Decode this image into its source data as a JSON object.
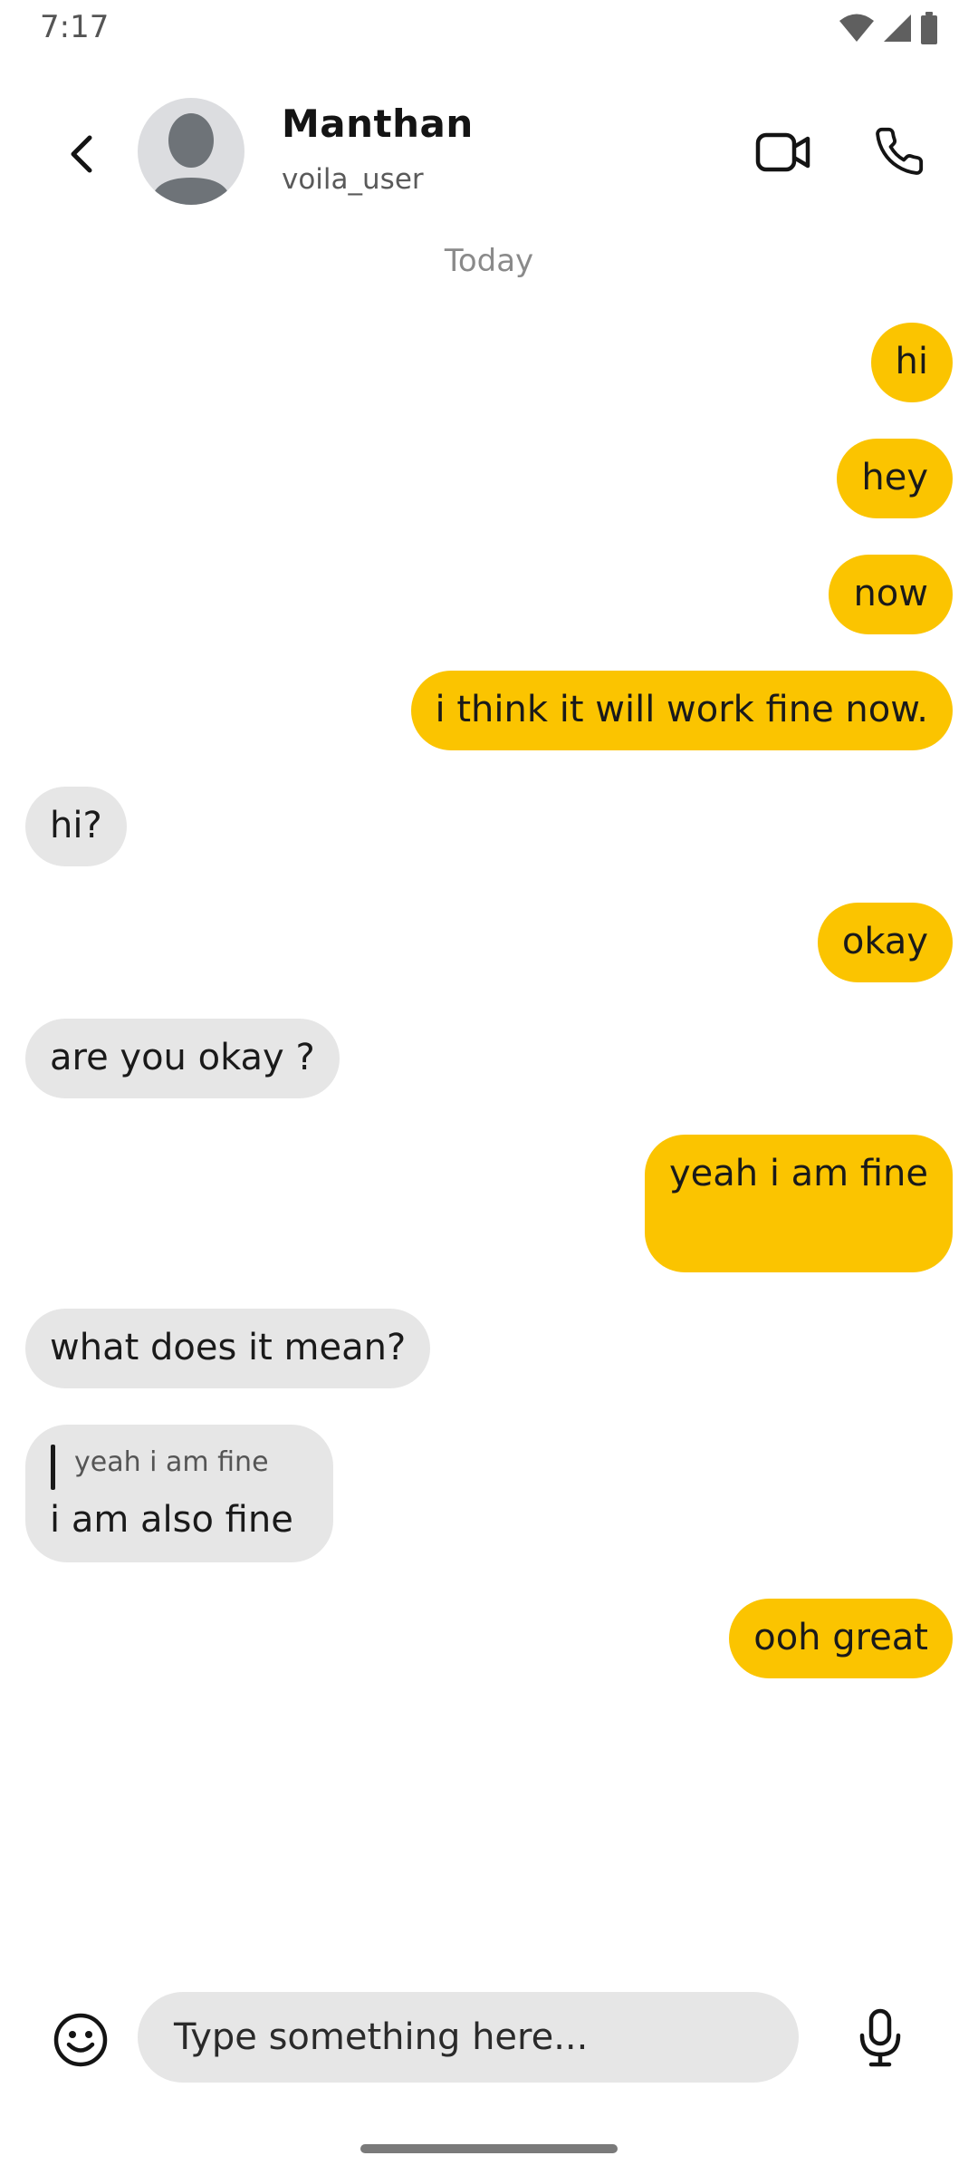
{
  "status_bar": {
    "time": "7:17"
  },
  "header": {
    "contact_name": "Manthan",
    "contact_username": "voila_user"
  },
  "chat": {
    "day_label": "Today",
    "messages": [
      {
        "direction": "sent",
        "text": "hi"
      },
      {
        "direction": "sent",
        "text": "hey"
      },
      {
        "direction": "sent",
        "text": "now"
      },
      {
        "direction": "sent",
        "text": "i think it will work fine now."
      },
      {
        "direction": "received",
        "text": "hi?"
      },
      {
        "direction": "sent",
        "text": "okay"
      },
      {
        "direction": "received",
        "text": "are you okay ?"
      },
      {
        "direction": "sent",
        "text": "yeah i am fine"
      },
      {
        "direction": "received",
        "text": "what does it mean?"
      },
      {
        "direction": "received",
        "text": "i am also fine",
        "quoted_text": "yeah i am fine"
      },
      {
        "direction": "sent",
        "text": "ooh great"
      }
    ]
  },
  "composer": {
    "placeholder": "Type something here..."
  },
  "colors": {
    "sent_bubble": "#fbc400",
    "received_bubble": "#e6e6e6",
    "input_background": "#e6e6e6",
    "avatar_background": "#dcdde0",
    "avatar_silhouette": "#6e7378"
  },
  "icons": {
    "back": "chevron-left-icon",
    "avatar": "person-silhouette-icon",
    "video": "video-camera-icon",
    "call": "phone-icon",
    "emoji": "smiley-icon",
    "mic": "microphone-icon",
    "status": [
      "wifi-icon",
      "cell-signal-icon",
      "battery-icon"
    ]
  }
}
